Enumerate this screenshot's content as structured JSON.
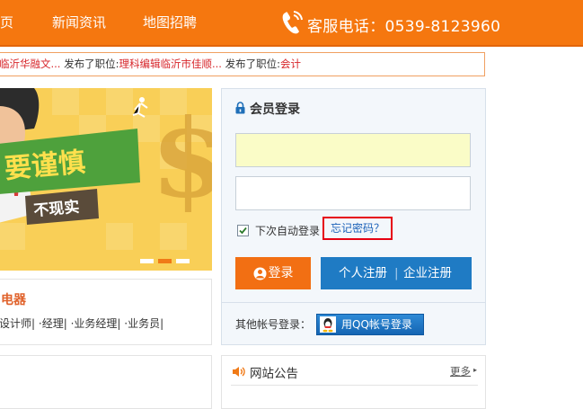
{
  "nav": {
    "items": [
      "页",
      "新闻资讯",
      "地图招聘"
    ],
    "hotline": "客服电话：0539-8123960",
    "color": "#f5770f"
  },
  "ticker": {
    "segments": [
      {
        "text": "临沂华融文...",
        "type": "link"
      },
      {
        "text": " 发布了职位:",
        "type": "plain"
      },
      {
        "text": "理科编辑临沂市佳顺...",
        "type": "link"
      },
      {
        "text": " 发布了职位:",
        "type": "plain"
      },
      {
        "text": "会计",
        "type": "link"
      }
    ]
  },
  "banner": {
    "text_main": "要谨慎",
    "text_sub": "不现实",
    "dots": 3,
    "active_dot": 1
  },
  "jobcard": {
    "title": "电器",
    "roles": [
      "设计师|",
      "·经理|",
      "·业务经理|",
      "·业务员|"
    ]
  },
  "login": {
    "heading": "会员登录",
    "username_value": "",
    "password_value": "",
    "remember_label": "下次自动登录",
    "remember_checked": true,
    "forgot_link": "忘记密码？",
    "login_button": "登录",
    "register_personal": "个人注册",
    "register_separator": "|",
    "register_company": "企业注册",
    "other_login_label": "其他帐号登录：",
    "qq_button": "用QQ帐号登录",
    "colors": {
      "login": "#f26f13",
      "register": "#1f7bc4",
      "highlight_border": "#e60012"
    }
  },
  "notice": {
    "title": "网站公告",
    "more": "更多",
    "more_arrow": "▸"
  }
}
